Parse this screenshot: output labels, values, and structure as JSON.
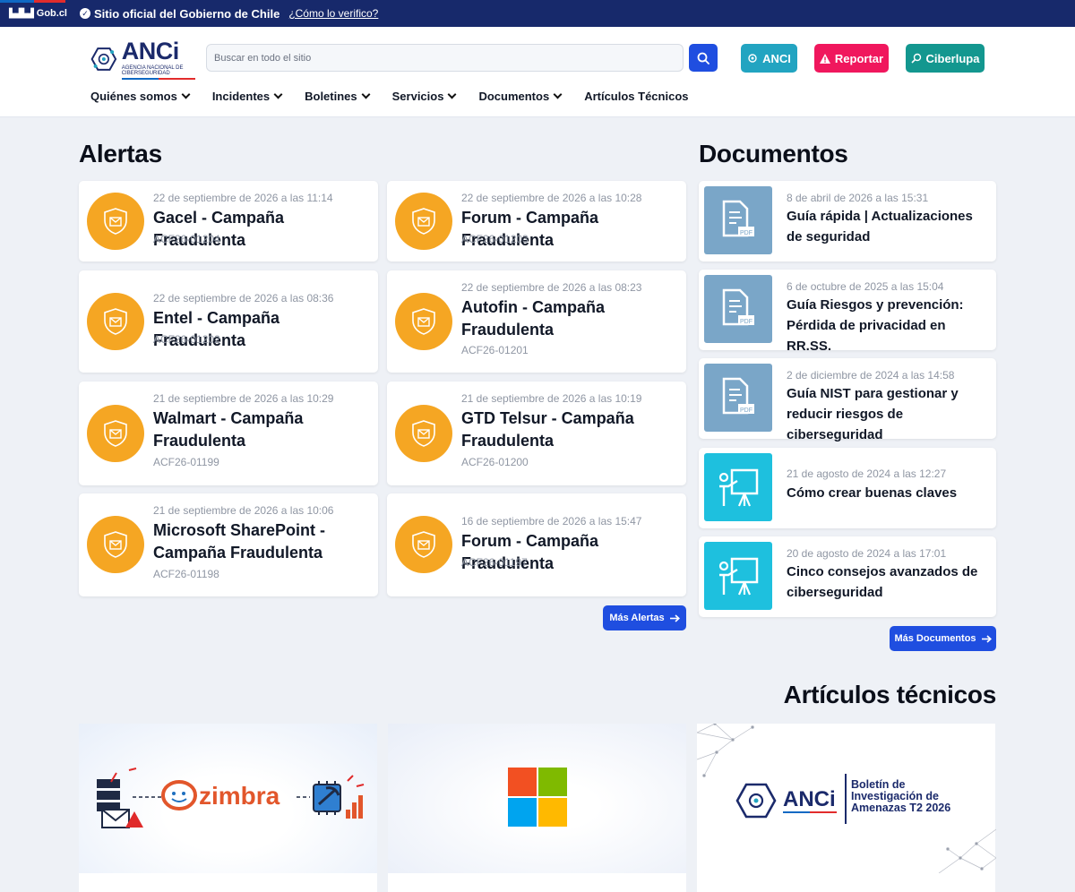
{
  "govbar": {
    "gob_label": "Gob.cl",
    "official_text": "Sitio oficial del Gobierno de Chile",
    "verify_link": "¿Cómo lo verifico?"
  },
  "header": {
    "logo_text": "ANCi",
    "logo_subtext": "AGENCIA NACIONAL DE CIBERSEGURIDAD",
    "search_placeholder": "Buscar en todo el sitio",
    "buttons": {
      "anci": "ANCI",
      "report": "Reportar",
      "ciberlupa": "Ciberlupa"
    },
    "nav": [
      "Quiénes somos",
      "Incidentes",
      "Boletines",
      "Servicios",
      "Documentos",
      "Artículos Técnicos"
    ]
  },
  "alerts": {
    "heading": "Alertas",
    "items": [
      {
        "date": "22 de septiembre de 2026 a las 11:14",
        "title": "Gacel - Campaña Fraudulenta",
        "code": "ACF26-01204"
      },
      {
        "date": "22 de septiembre de 2026 a las 10:28",
        "title": "Forum - Campaña Fraudulenta",
        "code": "ACF26-01203"
      },
      {
        "date": "22 de septiembre de 2026 a las 08:36",
        "title": "Entel - Campaña Fraudulenta",
        "code": "ACF26-01202"
      },
      {
        "date": "22 de septiembre de 2026 a las 08:23",
        "title": "Autofin - Campaña Fraudulenta",
        "code": "ACF26-01201"
      },
      {
        "date": "21 de septiembre de 2026 a las 10:29",
        "title": "Walmart - Campaña Fraudulenta",
        "code": "ACF26-01199"
      },
      {
        "date": "21 de septiembre de 2026 a las 10:19",
        "title": "GTD Telsur - Campaña Fraudulenta",
        "code": "ACF26-01200"
      },
      {
        "date": "21 de septiembre de 2026 a las 10:06",
        "title": "Microsoft SharePoint - Campaña Fraudulenta",
        "code": "ACF26-01198"
      },
      {
        "date": "16 de septiembre de 2026 a las 15:47",
        "title": "Forum - Campaña Fraudulenta",
        "code": "ACF26-01197"
      }
    ],
    "more_label": "Más Alertas"
  },
  "documents": {
    "heading": "Documentos",
    "items": [
      {
        "date": "8 de abril de 2026 a las 15:31",
        "title": "Guía rápida | Actualizaciones de seguridad",
        "icon": "pdf-icon"
      },
      {
        "date": "6 de octubre de 2025 a las 15:04",
        "title": "Guía Riesgos y prevención: Pérdida de privacidad en RR.SS.",
        "icon": "pdf-icon"
      },
      {
        "date": "2 de diciembre de 2024 a las 14:58",
        "title": "Guía NIST para gestionar y reducir riesgos de ciberseguridad",
        "icon": "pdf-icon"
      },
      {
        "date": "21 de agosto de 2024 a las 12:27",
        "title": "Cómo crear buenas claves",
        "icon": "presentation-icon"
      },
      {
        "date": "20 de agosto de 2024 a las 17:01",
        "title": "Cinco consejos avanzados de ciberseguridad",
        "icon": "presentation-icon"
      }
    ],
    "more_label": "Más Documentos"
  },
  "articles": {
    "heading": "Artículos técnicos",
    "items": [
      {
        "brand": "zimbra"
      },
      {
        "brand": ""
      },
      {
        "brand": "ANCi",
        "caption": "Boletín de Investigación de Amenazas T2 2026"
      }
    ]
  },
  "colors": {
    "gov_bar": "#17296b",
    "primary": "#1f4ee0",
    "alert_icon": "#f5a623",
    "report": "#f0175d",
    "anci": "#22a4c1",
    "ciberlupa": "#13978f"
  }
}
